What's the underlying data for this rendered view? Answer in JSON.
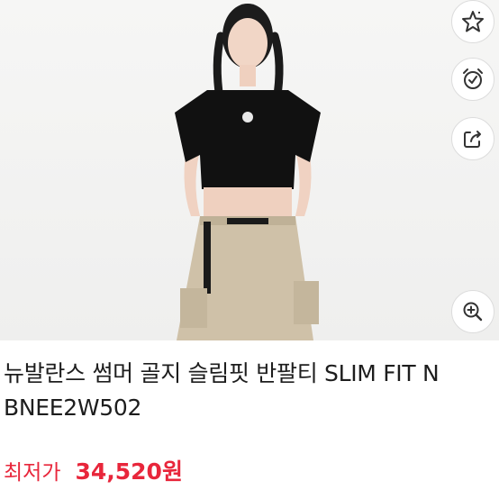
{
  "product": {
    "image_alt": "product-photo",
    "title": "뉴발란스 썸머 골지 슬림핏 반팔티 SLIM FIT N BNEE2W502",
    "price_label": "최저가",
    "price_value": "34,520원"
  },
  "actions": [
    {
      "name": "favorite-button",
      "icon": "star-icon"
    },
    {
      "name": "price-alert-button",
      "icon": "alarm-clock-icon"
    },
    {
      "name": "share-button",
      "icon": "share-icon"
    },
    {
      "name": "zoom-button",
      "icon": "zoom-in-icon"
    }
  ],
  "colors": {
    "price": "#e8263b",
    "text": "#1d1d1d",
    "icon": "#333333"
  }
}
